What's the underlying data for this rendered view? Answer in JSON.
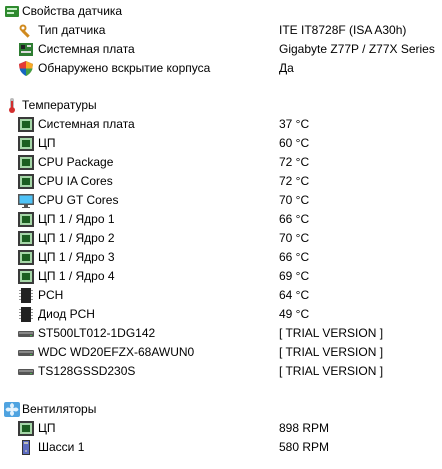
{
  "sensor_section": {
    "title": "Свойства датчика",
    "icon": "sensor-properties-icon",
    "items": [
      {
        "label": "Тип датчика",
        "value": "ITE IT8728F  (ISA A30h)",
        "icon": "wrench-icon"
      },
      {
        "label": "Системная плата",
        "value": "Gigabyte Z77P / Z77X Series",
        "icon": "motherboard-icon"
      },
      {
        "label": "Обнаружено вскрытие корпуса",
        "value": "Да",
        "icon": "shield-icon"
      }
    ]
  },
  "temperatures": {
    "title": "Температуры",
    "icon": "thermometer-icon",
    "items": [
      {
        "label": "Системная плата",
        "value": "37 °C",
        "icon": "chip-icon"
      },
      {
        "label": "ЦП",
        "value": "60 °C",
        "icon": "chip-icon"
      },
      {
        "label": "CPU Package",
        "value": "72 °C",
        "icon": "chip-icon"
      },
      {
        "label": "CPU IA Cores",
        "value": "72 °C",
        "icon": "chip-icon"
      },
      {
        "label": "CPU GT Cores",
        "value": "70 °C",
        "icon": "monitor-icon"
      },
      {
        "label": "ЦП 1 / Ядро 1",
        "value": "66 °C",
        "icon": "chip-icon"
      },
      {
        "label": "ЦП 1 / Ядро 2",
        "value": "70 °C",
        "icon": "chip-icon"
      },
      {
        "label": "ЦП 1 / Ядро 3",
        "value": "66 °C",
        "icon": "chip-icon"
      },
      {
        "label": "ЦП 1 / Ядро 4",
        "value": "69 °C",
        "icon": "chip-icon"
      },
      {
        "label": "PCH",
        "value": "64 °C",
        "icon": "pch-chip-icon"
      },
      {
        "label": "Диод PCH",
        "value": "49 °C",
        "icon": "pch-chip-icon"
      },
      {
        "label": "ST500LT012-1DG142",
        "value": "[ TRIAL VERSION ]",
        "icon": "hard-drive-icon"
      },
      {
        "label": "WDC WD20EFZX-68AWUN0",
        "value": "[ TRIAL VERSION ]",
        "icon": "hard-drive-icon"
      },
      {
        "label": "TS128GSSD230S",
        "value": "[ TRIAL VERSION ]",
        "icon": "hard-drive-icon"
      }
    ]
  },
  "fans": {
    "title": "Вентиляторы",
    "icon": "fan-icon",
    "items": [
      {
        "label": "ЦП",
        "value": "898 RPM",
        "icon": "chip-icon"
      },
      {
        "label": "Шасси 1",
        "value": "580 RPM",
        "icon": "case-icon"
      }
    ]
  }
}
